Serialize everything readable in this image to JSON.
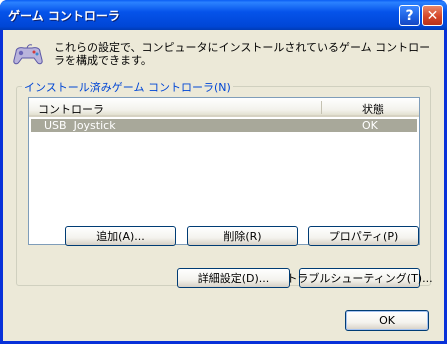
{
  "window": {
    "title": "ゲーム コントローラ",
    "help_label": "?",
    "close_label": "✕"
  },
  "description": "これらの設定で、コンピュータにインストールされているゲーム コントローラを構成できます。",
  "group": {
    "legend": "インストール済みゲーム コントローラ(N)"
  },
  "list": {
    "columns": [
      "コントローラ",
      "状態"
    ],
    "rows": [
      {
        "controller": "USB  Joystick",
        "status": "OK"
      }
    ]
  },
  "buttons": {
    "add": "追加(A)...",
    "remove": "削除(R)",
    "properties": "プロパティ(P)",
    "advanced": "詳細設定(D)...",
    "troubleshoot": "トラブルシューティング(T)...",
    "ok": "OK"
  },
  "icons": {
    "gamepad": "gamepad-icon",
    "help": "help-icon",
    "close": "close-icon"
  }
}
